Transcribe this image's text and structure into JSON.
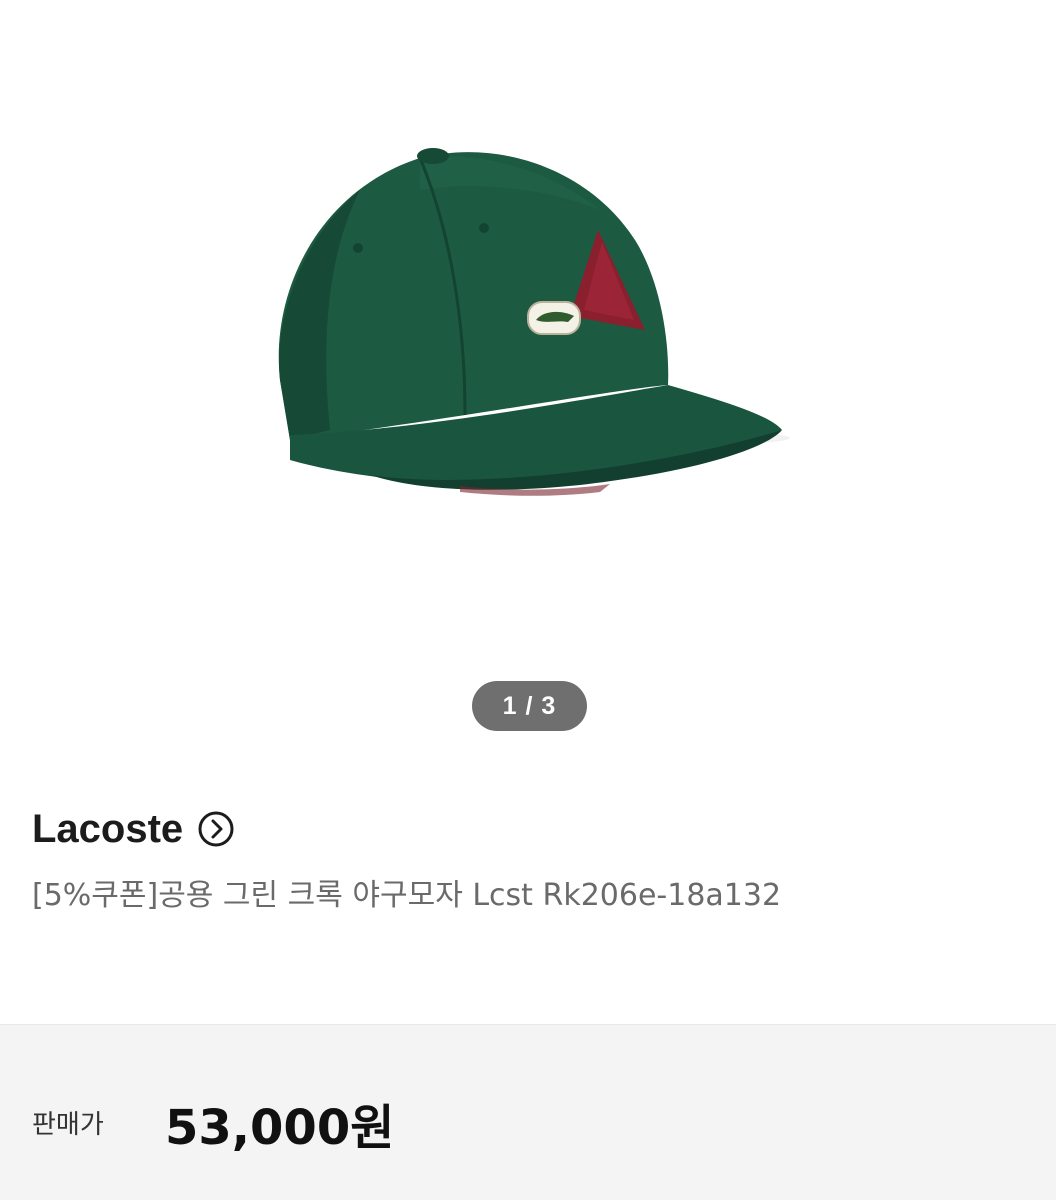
{
  "gallery": {
    "image_alt": "green baseball cap",
    "indicator": "1 / 3"
  },
  "product": {
    "brand": "Lacoste",
    "brand_arrow_icon": "chevron-right-circle-icon",
    "title": "[5%쿠폰]공용 그린 크록 야구모자 Lcst Rk206e-18a132"
  },
  "price": {
    "label": "판매가",
    "value": "53,000원"
  },
  "colors": {
    "cap_green": "#174f39",
    "indicator_bg": "#6f6f6f",
    "price_bar_bg": "#f4f4f4"
  }
}
